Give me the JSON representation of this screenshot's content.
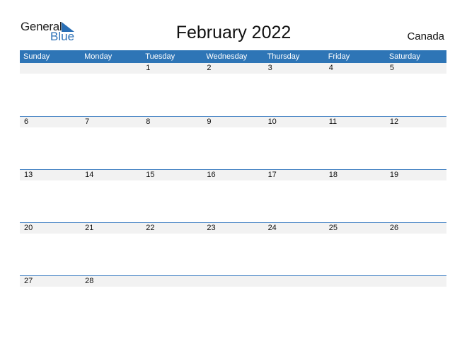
{
  "logo": {
    "line1": "General",
    "line2": "Blue"
  },
  "title": "February 2022",
  "country": "Canada",
  "colors": {
    "header": "#2e75b6",
    "accent": "#2a6fb5"
  },
  "weekdays": [
    "Sunday",
    "Monday",
    "Tuesday",
    "Wednesday",
    "Thursday",
    "Friday",
    "Saturday"
  ],
  "weeks": [
    [
      "",
      "",
      "1",
      "2",
      "3",
      "4",
      "5"
    ],
    [
      "6",
      "7",
      "8",
      "9",
      "10",
      "11",
      "12"
    ],
    [
      "13",
      "14",
      "15",
      "16",
      "17",
      "18",
      "19"
    ],
    [
      "20",
      "21",
      "22",
      "23",
      "24",
      "25",
      "26"
    ],
    [
      "27",
      "28",
      "",
      "",
      "",
      "",
      ""
    ]
  ]
}
